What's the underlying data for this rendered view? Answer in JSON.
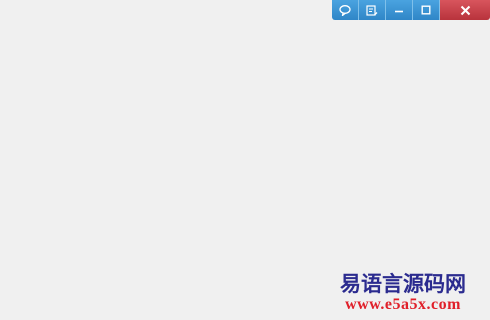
{
  "window": {
    "background": "#f0f0f0"
  },
  "caption_buttons": [
    {
      "name": "feedback-button",
      "icon": "speech-bubble-icon"
    },
    {
      "name": "skin-button",
      "icon": "list-edit-icon"
    },
    {
      "name": "minimize-button",
      "icon": "minimize-icon"
    },
    {
      "name": "maximize-button",
      "icon": "maximize-icon"
    },
    {
      "name": "close-button",
      "icon": "close-icon"
    }
  ],
  "colors": {
    "caption_blue": "#3a96d6",
    "close_red": "#c6434b",
    "watermark_title": "#2b2b8f",
    "watermark_url": "#e0202a"
  },
  "watermark": {
    "title": "易语言源码网",
    "url": "www.e5a5x.com"
  }
}
